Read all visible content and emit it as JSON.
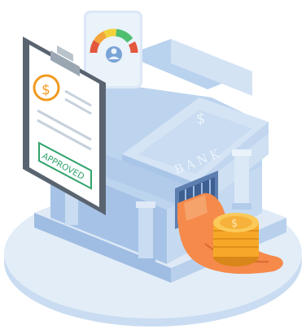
{
  "illustration": {
    "bank_sign": "BANK",
    "stamp_text": "APPROVED",
    "clipboard_symbol": "$",
    "pediment_symbol": "$",
    "coin_symbol": "$",
    "icons": [
      "clipboard-icon",
      "credit-score-gauge-icon",
      "bank-building-icon",
      "hand-icon",
      "coin-stack-icon"
    ],
    "colors": {
      "platform": "#dbe8f6",
      "bank_light": "#c7dbf1",
      "bank_mid": "#a9c6e8",
      "bank_dark": "#7fa3cf",
      "clipboard_board": "#5a6470",
      "stamp_green": "#2fa36b",
      "coin_gold": "#f6a928",
      "hand_skin": "#f58a4b"
    }
  }
}
